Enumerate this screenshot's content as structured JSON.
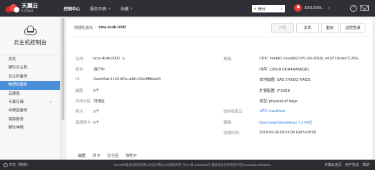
{
  "topbar": {
    "logo_cn": "天翼云",
    "logo_en": "e Cloud",
    "nav": [
      {
        "label": "控制中心",
        "active": true
      },
      {
        "label": "服务列表",
        "has_dropdown": true
      },
      {
        "label": "收藏",
        "has_dropdown": true
      }
    ],
    "region": "贵州",
    "user_phone": "18910298..."
  },
  "sidebar": {
    "title": "云主机控制台",
    "items": [
      {
        "label": "总览"
      },
      {
        "label": "弹性云主机"
      },
      {
        "label": "云主机备份"
      },
      {
        "label": "物理机服务",
        "active": true
      },
      {
        "label": "云硬盘"
      },
      {
        "label": "专属存储",
        "has_dropdown": true
      },
      {
        "label": "云硬盘备份"
      },
      {
        "label": "镜像服务"
      },
      {
        "label": "弹性伸缩"
      }
    ]
  },
  "breadcrumb": {
    "parent": "物理机服务",
    "separator": "›",
    "current": "bms-4c4b-0002"
  },
  "actions": {
    "start": "开机",
    "stop": "关机",
    "reboot": "重启",
    "remote": "远程登录"
  },
  "details": {
    "left": [
      {
        "label": "名称:",
        "value": "bms-4c4b-0002",
        "editable": true
      },
      {
        "label": "状态:",
        "value": "运行中",
        "style": "green"
      },
      {
        "label": "ID:",
        "value": "2eac55af-4103-4f2a-a0d1-66e3fff84ad3"
      },
      {
        "label": "磁盘:",
        "value": "0个"
      },
      {
        "label": "可用分区:",
        "value": "可用区"
      },
      {
        "label": "网卡:",
        "value": "2个"
      },
      {
        "label": "高速网卡:",
        "value": "0个"
      }
    ],
    "right": [
      {
        "label": "规格:",
        "value": "CPU: Intel(R) Xeon(R) CPU E5-2618L v4 (2*10core*2.20G"
      },
      {
        "label": "",
        "value": "内存: 128GB DDR4RAM(GB)"
      },
      {
        "label": "",
        "value": "本地磁盘: SAS 2*600G RAID1"
      },
      {
        "label": "",
        "value": "扩展配置: 2*10GE"
      },
      {
        "label": "",
        "value": "类型: physical.s2.large"
      },
      {
        "label": "虚拟私有云:",
        "value": "VPC-oracletest",
        "style": "link"
      },
      {
        "label": "镜像:",
        "value": "Baremetal Oraclelinux 7.3 64位",
        "style": "link"
      },
      {
        "label": "创建时间:",
        "value": "2018-09-06 09:34:08 GMT+08:00"
      }
    ]
  },
  "tabs": [
    {
      "label": "磁盘",
      "active": true
    },
    {
      "label": "网卡"
    },
    {
      "label": "安全组"
    },
    {
      "label": "弹性IP"
    }
  ],
  "footer": {
    "language": "中文（简体）",
    "copyright": "©2018中国电信股份有限公司云计算分公司版权所有 京ICP备 12022551号 增值电信业务经营许可证A2.B1.B2-20090001",
    "links": [
      "天翼云首页",
      "用户协议",
      "帮助"
    ]
  }
}
